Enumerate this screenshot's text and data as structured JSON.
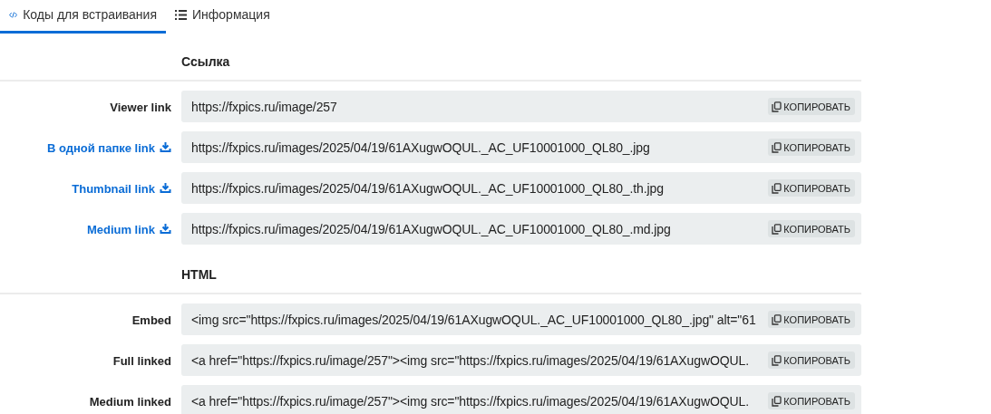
{
  "tabs": [
    {
      "label": "Коды для встраивания",
      "selected": true
    },
    {
      "label": "Информация",
      "selected": false
    }
  ],
  "sections": [
    {
      "title": "Ссылка",
      "rows": [
        {
          "label": "Viewer link",
          "download": false,
          "value": "https://fxpics.ru/image/257",
          "button": "КОПИРОВАТЬ"
        },
        {
          "label": "В одной папке link",
          "download": true,
          "value": "https://fxpics.ru/images/2025/04/19/61AXugwOQUL._AC_UF10001000_QL80_.jpg",
          "button": "КОПИРОВАТЬ"
        },
        {
          "label": "Thumbnail link",
          "download": true,
          "value": "https://fxpics.ru/images/2025/04/19/61AXugwOQUL._AC_UF10001000_QL80_.th.jpg",
          "button": "КОПИРОВАТЬ"
        },
        {
          "label": "Medium link",
          "download": true,
          "value": "https://fxpics.ru/images/2025/04/19/61AXugwOQUL._AC_UF10001000_QL80_.md.jpg",
          "button": "КОПИРОВАТЬ"
        }
      ]
    },
    {
      "title": "HTML",
      "rows": [
        {
          "label": "Embed",
          "download": false,
          "value": "<img src=\"https://fxpics.ru/images/2025/04/19/61AXugwOQUL._AC_UF10001000_QL80_.jpg\" alt=\"61",
          "button": "КОПИРОВАТЬ"
        },
        {
          "label": "Full linked",
          "download": false,
          "value": "<a href=\"https://fxpics.ru/image/257\"><img src=\"https://fxpics.ru/images/2025/04/19/61AXugwOQUL.",
          "button": "КОПИРОВАТЬ"
        },
        {
          "label": "Medium linked",
          "download": false,
          "value": "<a href=\"https://fxpics.ru/image/257\"><img src=\"https://fxpics.ru/images/2025/04/19/61AXugwOQUL.",
          "button": "КОПИРОВАТЬ"
        }
      ]
    }
  ]
}
